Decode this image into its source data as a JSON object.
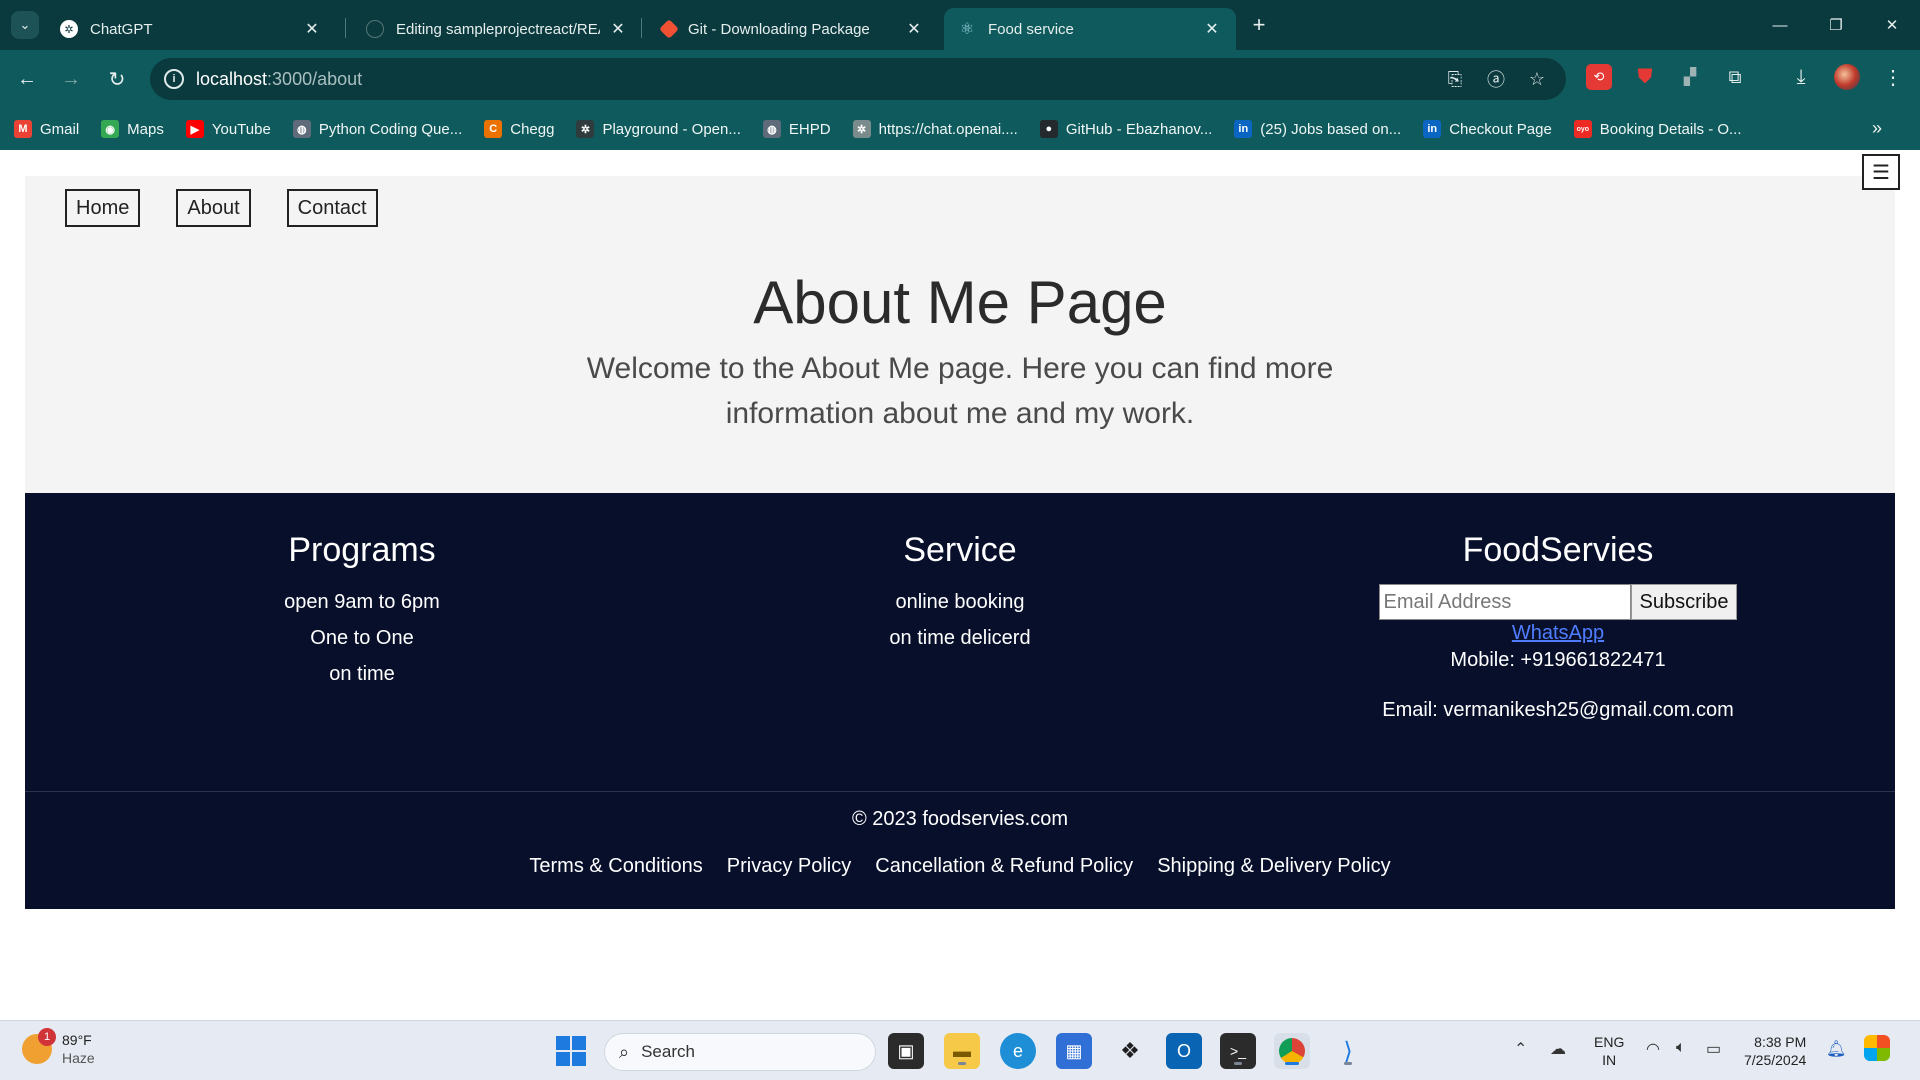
{
  "browser": {
    "tabs": [
      {
        "title": "ChatGPT",
        "active": false
      },
      {
        "title": "Editing sampleprojectreact/REA",
        "active": false
      },
      {
        "title": "Git - Downloading Package",
        "active": false
      },
      {
        "title": "Food service",
        "active": true
      }
    ],
    "tab_close_glyph": "✕",
    "new_tab_glyph": "+",
    "address": {
      "host": "localhost",
      "path": ":3000/about"
    },
    "bookmarks": [
      {
        "label": "Gmail",
        "icon": "gmail-icon",
        "color": "#ea4335",
        "glyph": "M"
      },
      {
        "label": "Maps",
        "icon": "maps-icon",
        "color": "#34a853",
        "glyph": "◉"
      },
      {
        "label": "YouTube",
        "icon": "youtube-icon",
        "color": "#ff0000",
        "glyph": "▶"
      },
      {
        "label": "Python Coding Que...",
        "icon": "globe-icon",
        "color": "#5f6b7a",
        "glyph": "◍"
      },
      {
        "label": "Chegg",
        "icon": "chegg-icon",
        "color": "#eb7100",
        "glyph": "C"
      },
      {
        "label": "Playground - Open...",
        "icon": "openai-icon",
        "color": "#2f3b3c",
        "glyph": "✲"
      },
      {
        "label": "EHPD",
        "icon": "globe-icon",
        "color": "#5f6b7a",
        "glyph": "◍"
      },
      {
        "label": "https://chat.openai....",
        "icon": "openai-icon",
        "color": "#7a8b8c",
        "glyph": "✲"
      },
      {
        "label": "GitHub - Ebazhanov...",
        "icon": "github-icon",
        "color": "#24292e",
        "glyph": "●"
      },
      {
        "label": "(25) Jobs based on...",
        "icon": "linkedin-icon",
        "color": "#0a66c2",
        "glyph": "in"
      },
      {
        "label": "Checkout Page",
        "icon": "linkedin-icon",
        "color": "#0a66c2",
        "glyph": "in"
      },
      {
        "label": "Booking Details - O...",
        "icon": "oyo-icon",
        "color": "#ee2a24",
        "glyph": "oyo"
      }
    ]
  },
  "page": {
    "nav": [
      "Home",
      "About",
      "Contact"
    ],
    "menu_glyph": "☰",
    "title": "About Me Page",
    "intro": "Welcome to the About Me page. Here you can find more information about me and my work.",
    "footer": {
      "programs": {
        "heading": "Programs",
        "lines": [
          "open 9am to 6pm",
          "One to One",
          "on time"
        ]
      },
      "service": {
        "heading": "Service",
        "lines": [
          "online booking",
          "on time delicerd"
        ]
      },
      "foodservies": {
        "heading": "FoodServies",
        "email_placeholder": "Email Address",
        "subscribe_label": "Subscribe",
        "whatsapp_alt": "WhatsApp",
        "mobile": "Mobile: +919661822471",
        "email": "Email: vermanikesh25@gmail.com.com"
      },
      "copyright": "© 2023 foodservies.com",
      "policies": [
        "Terms & Conditions",
        "Privacy Policy",
        "Cancellation & Refund Policy",
        "Shipping & Delivery Policy"
      ]
    }
  },
  "taskbar": {
    "weather": {
      "temp": "89°F",
      "condition": "Haze",
      "badge": "1"
    },
    "search_label": "Search",
    "language": {
      "line1": "ENG",
      "line2": "IN"
    },
    "clock": {
      "time": "8:38 PM",
      "date": "7/25/2024"
    }
  },
  "colors": {
    "chrome_frame": "#0a3a3e",
    "chrome_toolbar": "#0f5a5c",
    "hero_bg": "#f4f4f4",
    "footer_bg": "#070f2b",
    "link_blue": "#4f7dff"
  }
}
